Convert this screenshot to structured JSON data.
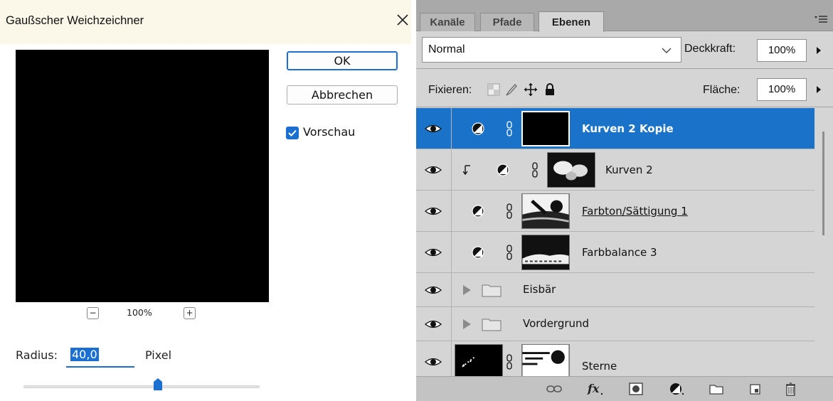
{
  "dialog": {
    "title": "Gaußscher Weichzeichner",
    "ok_label": "OK",
    "cancel_label": "Abbrechen",
    "preview_label": "Vorschau",
    "preview_checked": true,
    "zoom_value": "100%",
    "zoom_out_label": "−",
    "zoom_in_label": "+",
    "radius_label": "Radius:",
    "radius_value": "40,0",
    "radius_unit": "Pixel",
    "radius_slider_fraction": 0.57,
    "accent_color": "#1a6fd1"
  },
  "panel": {
    "tabs": [
      "Kanäle",
      "Pfade",
      "Ebenen"
    ],
    "active_tab": "Ebenen",
    "blend_mode": "Normal",
    "opacity_label": "Deckkraft:",
    "opacity_value": "100%",
    "lock_label": "Fixieren:",
    "fill_label": "Fläche:",
    "fill_value": "100%",
    "selection_color": "#1a73c9",
    "layers": [
      {
        "name": "Kurven 2 Kopie",
        "kind": "adjustment",
        "selected": true
      },
      {
        "name": "Kurven 2",
        "kind": "adjustment",
        "clipped": true
      },
      {
        "name": "Farbton/Sättigung 1",
        "kind": "adjustment",
        "underlined": true
      },
      {
        "name": "Farbbalance 3",
        "kind": "adjustment"
      },
      {
        "name": "Eisbär",
        "kind": "group"
      },
      {
        "name": "Vordergrund",
        "kind": "group"
      },
      {
        "name": "Sterne",
        "kind": "layer-with-mask"
      }
    ],
    "bottom_icons": [
      "link-layers-icon",
      "fx-icon",
      "add-mask-icon",
      "new-adjustment-icon",
      "new-group-icon",
      "new-layer-icon",
      "trash-icon"
    ]
  }
}
